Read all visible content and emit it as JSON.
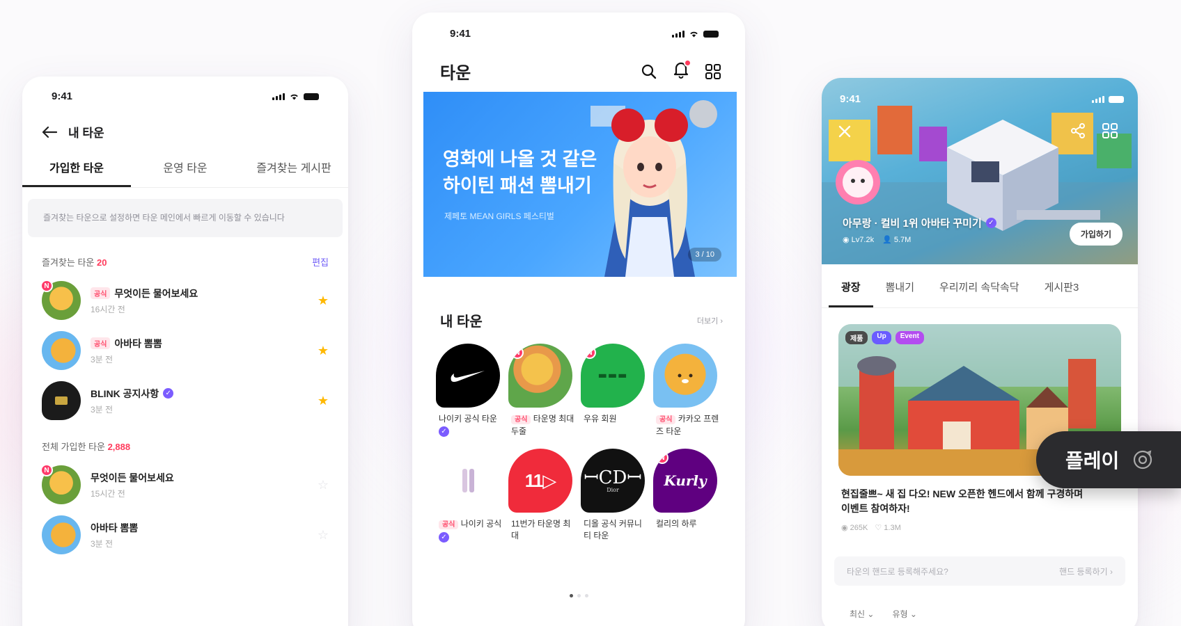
{
  "status_time": "9:41",
  "left": {
    "back_title": "내 타운",
    "tabs": [
      "가입한 타운",
      "운영 타운",
      "즐겨찾는 게시판"
    ],
    "notice": "즐겨찾는 타운으로 설정하면 타운 메인에서 빠르게 이동할 수 있습니다",
    "fav_label": "즐겨찾는 타운",
    "fav_count": "20",
    "edit_label": "편집",
    "fav_rows": [
      {
        "tag": "공식",
        "title": "무엇이든 물어보세요",
        "sub": "16시간 전",
        "badge": "N"
      },
      {
        "tag": "공식",
        "title": "아바타 뽐뽐",
        "sub": "3분 전",
        "badge": ""
      },
      {
        "tag": "",
        "title": "BLINK 공지사항",
        "sub": "3분 전",
        "badge": ""
      }
    ],
    "all_label": "전체 가입한 타운",
    "all_count": "2,888",
    "all_rows": [
      {
        "title": "무엇이든 물어보세요",
        "sub": "15시간 전",
        "badge": "N"
      },
      {
        "title": "아바타 뽐뽐",
        "sub": "3분 전",
        "badge": ""
      }
    ]
  },
  "center": {
    "title": "타운",
    "notif_count": "",
    "banner_title": "영화에 나올 것 같은\n하이틴 패션 뽐내기",
    "banner_sub": "제페토 MEAN GIRLS 페스티벌",
    "banner_page": "3 / 10",
    "my_town_label": "내 타운",
    "more_label": "더보기 ›",
    "towns": [
      {
        "name": "나이키 공식 타운",
        "color": "#000000",
        "logo": "✔",
        "logo_color": "#ffffff",
        "badge": "",
        "verified": true,
        "tag": ""
      },
      {
        "name": "타운명 최대 두줄",
        "color": "#7bb6e0",
        "logo": "",
        "logo_color": "#ffffff",
        "badge": "N",
        "verified": false,
        "tag": "공식"
      },
      {
        "name": "우유 회원",
        "color": "#22b24c",
        "logo": "milk",
        "logo_color": "#0d5a22",
        "badge": "N",
        "verified": false,
        "tag": ""
      },
      {
        "name": "카카오 프렌즈 타운",
        "color": "#f3c34a",
        "logo": "",
        "logo_color": "#ffffff",
        "badge": "",
        "verified": false,
        "tag": "공식"
      },
      {
        "name": "나이키 공식",
        "color": "#ffffff",
        "logo": "▮▮",
        "logo_color": "#c9b3d6",
        "badge": "",
        "verified": true,
        "tag": "공식"
      },
      {
        "name": "11번가 타운명 최대",
        "color": "#f02b3b",
        "logo": "11▷",
        "logo_color": "#ffffff",
        "badge": "",
        "verified": false,
        "tag": ""
      },
      {
        "name": "디올 공식 커뮤니티 타운",
        "color": "#111111",
        "logo": "CD",
        "logo_color": "#ffffff",
        "badge": "",
        "verified": false,
        "tag": ""
      },
      {
        "name": "컬리의 하루",
        "color": "#5f0080",
        "logo": "Kurly",
        "logo_color": "#ffffff",
        "badge": "N",
        "verified": false,
        "tag": ""
      }
    ]
  },
  "right": {
    "town_name": "아무랑 · 컬비 1위 아바타 꾸미기",
    "meta_views": "Lv7.2k",
    "meta_members": "5.7M",
    "join_label": "가입하기",
    "tabs": [
      "광장",
      "뽐내기",
      "우리끼리 속닥속닥",
      "게시판3"
    ],
    "chips": [
      {
        "label": "제품",
        "color": "#4a4a4a"
      },
      {
        "label": "Up",
        "color": "#6a5cff"
      },
      {
        "label": "Event",
        "color": "#b34cf0"
      }
    ],
    "post_title": "현집줄쁘~ 새 집 다오! NEW 오픈한 헨드에서 함께 구경하며 이벤트 참여하자!",
    "post_views": "265K",
    "post_likes": "1.3M",
    "search_placeholder": "타운의 핸드로 등록해주세요?",
    "search_right": "핸드 등록하기 ›",
    "filters": [
      "최신 ⌄",
      "유형 ⌄"
    ],
    "play_label": "플레이"
  }
}
